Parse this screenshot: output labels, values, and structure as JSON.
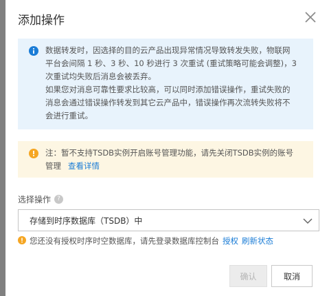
{
  "dialog": {
    "title": "添加操作"
  },
  "info_notice": {
    "line1": "数据转发时，因选择的目的云产品出现异常情况导致转发失败，物联网",
    "line2": "平台会间隔 1 秒、3 秒、10 秒进行 3 次重试 (重试策略可能会调整)，3",
    "line3": "次重试均失败后消息会被丢弃。",
    "line4": "如果您对消息可靠性要求比较高，可以同时添加错误操作，重试失败的",
    "line5": "消息会通过错误操作转发到其它云产品中，错误操作再次流转失败将不",
    "line6": "会进行重试。"
  },
  "warning_notice": {
    "line1": "注：暂不支持TSDB实例开启账号管理功能，请先关闭TSDB实例的账号",
    "line2": "管理",
    "details_link": "查看详情"
  },
  "select_action": {
    "label": "选择操作",
    "help_symbol": "?",
    "selected_value": "存储到时序数据库（TSDB）中"
  },
  "auth_tip": {
    "text": "您还没有授权时序时空数据库，请先登录数据库控制台",
    "authorize_link": "授权",
    "refresh_link": "刷新状态"
  },
  "footer": {
    "confirm_label": "确认",
    "cancel_label": "取消"
  },
  "colors": {
    "info_bg": "#e8f3fc",
    "info_icon": "#1a7cd6",
    "warning_bg": "#fdf6e3",
    "warning_icon": "#f5a623",
    "link": "#1a7cd6"
  }
}
